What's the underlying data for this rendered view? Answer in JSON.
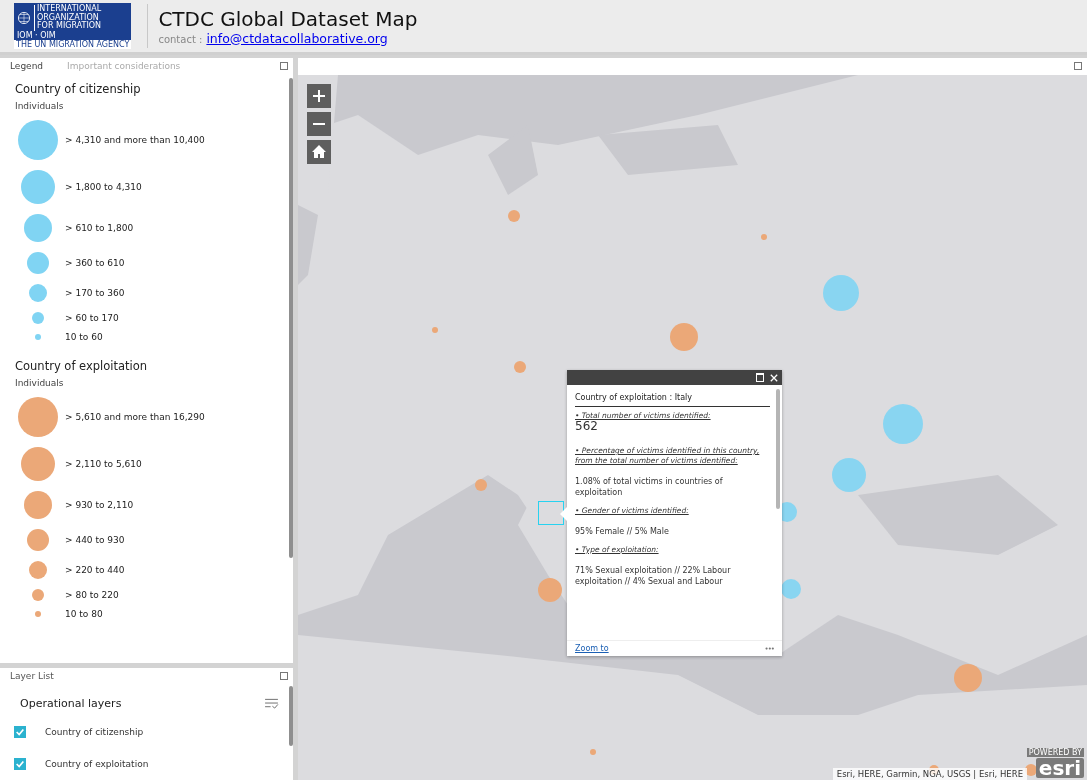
{
  "header": {
    "logo": {
      "org_lines": [
        "INTERNATIONAL",
        "ORGANIZATION",
        "FOR MIGRATION"
      ],
      "short": "IOM · OIM",
      "tagline": "THE UN MIGRATION AGENCY"
    },
    "title": "CTDC Global Dataset Map",
    "contact_label": "contact :",
    "contact_link": "info@ctdatacollaborative.org"
  },
  "legend_panel": {
    "tabs": [
      {
        "label": "Legend",
        "selected": true
      },
      {
        "label": "Important considerations",
        "selected": false
      }
    ],
    "groups": [
      {
        "title": "Country of citizenship",
        "subtitle": "Individuals",
        "color": "#80d4f3",
        "classes": [
          "> 4,310 and more than 10,400",
          "> 1,800 to 4,310",
          "> 610 to 1,800",
          "> 360 to 610",
          "> 170 to 360",
          "> 60 to 170",
          "10 to 60"
        ]
      },
      {
        "title": "Country of exploitation",
        "subtitle": "Individuals",
        "color": "#eba878",
        "classes": [
          "> 5,610 and more than 16,290",
          "> 2,110 to 5,610",
          "> 930 to 2,110",
          "> 440 to 930",
          "> 220 to 440",
          "> 80 to 220",
          "10 to 80"
        ]
      }
    ]
  },
  "layer_list": {
    "title": "Layer List",
    "heading": "Operational layers",
    "layers": [
      {
        "label": "Country of citizenship",
        "checked": true
      },
      {
        "label": "Country of exploitation",
        "checked": true
      }
    ]
  },
  "map": {
    "kind": "picture",
    "popup": {
      "title": "Country of exploitation : Italy",
      "sections": [
        {
          "heading": "• Total number of victims identified:",
          "value": "562",
          "kind": "number"
        },
        {
          "heading": "• Percentage of victims identified in this country, from the total number of victims identified:",
          "value": "1.08% of total victims in countries of exploitation",
          "kind": "text"
        },
        {
          "heading": "• Gender of victims identified:",
          "value": "95% Female // 5% Male",
          "kind": "text"
        },
        {
          "heading": "• Type of exploitation:",
          "value": "71% Sexual exploitation // 22% Labour exploitation // 4% Sexual and Labour",
          "kind": "text"
        }
      ],
      "zoom_link": "Zoom to",
      "more": "•••"
    },
    "attribution": "Esri, HERE, Garmin, NGA, USGS | Esri, HERE",
    "esri_powered": "POWERED BY",
    "esri_logo": "esri"
  }
}
